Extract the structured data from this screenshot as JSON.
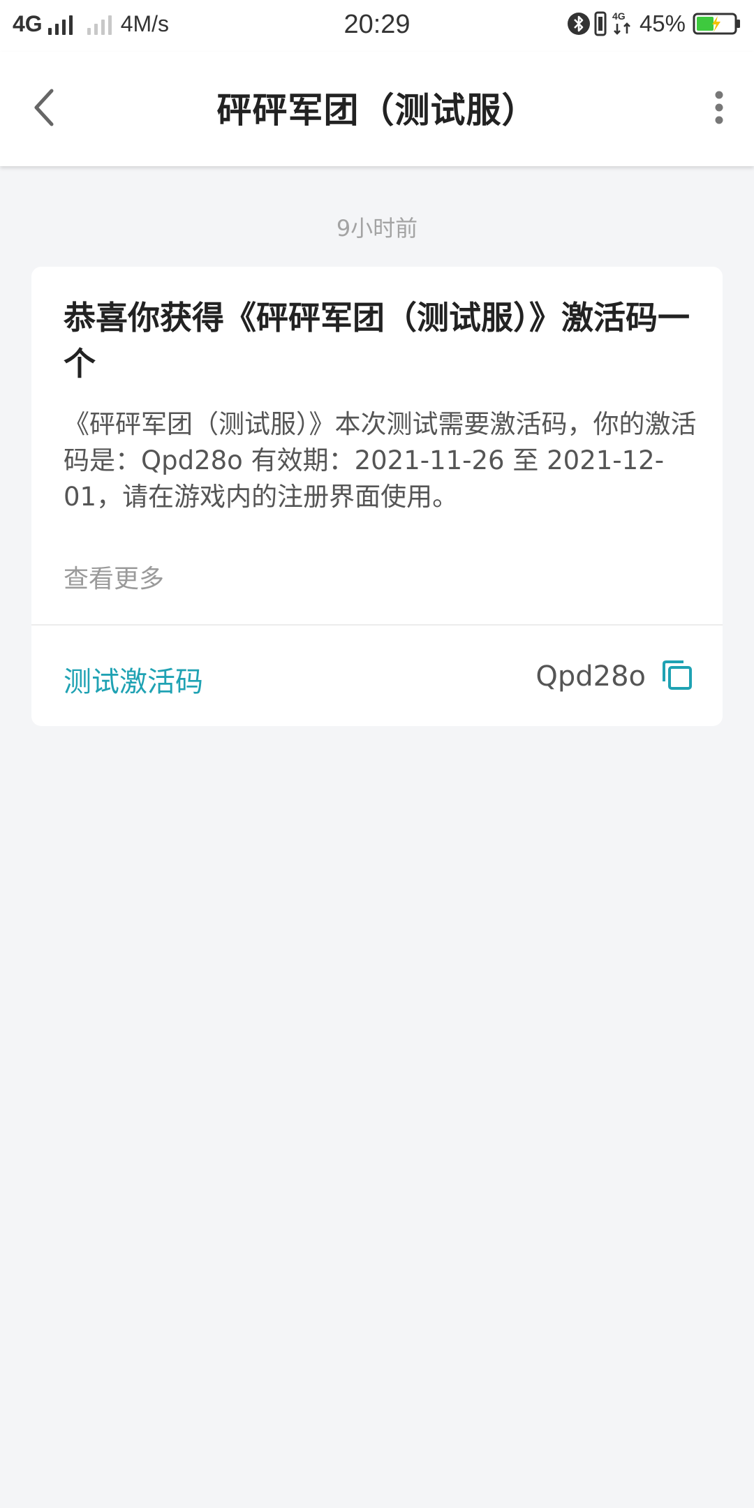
{
  "status_bar": {
    "network": "4G",
    "speed": "4M/s",
    "time": "20:29",
    "battery_percent": "45%",
    "battery_level": 0.45,
    "secondary_network": "4G"
  },
  "header": {
    "title": "砰砰军团（测试服）",
    "back_icon": "chevron-left-icon",
    "more_icon": "more-vertical-icon"
  },
  "message": {
    "time": "9小时前",
    "title": "恭喜你获得《砰砰军团（测试服）》激活码一个",
    "body": "《砰砰军团（测试服）》本次测试需要激活码，你的激活码是：Qpd28o 有效期：2021-11-26 至 2021-12-01，请在游戏内的注册界面使用。",
    "view_more": "查看更多",
    "code_label": "测试激活码",
    "code_value": "Qpd28o",
    "copy_icon": "copy-icon"
  },
  "colors": {
    "accent": "#1fa2b3",
    "background": "#f4f5f7",
    "card": "#ffffff"
  }
}
